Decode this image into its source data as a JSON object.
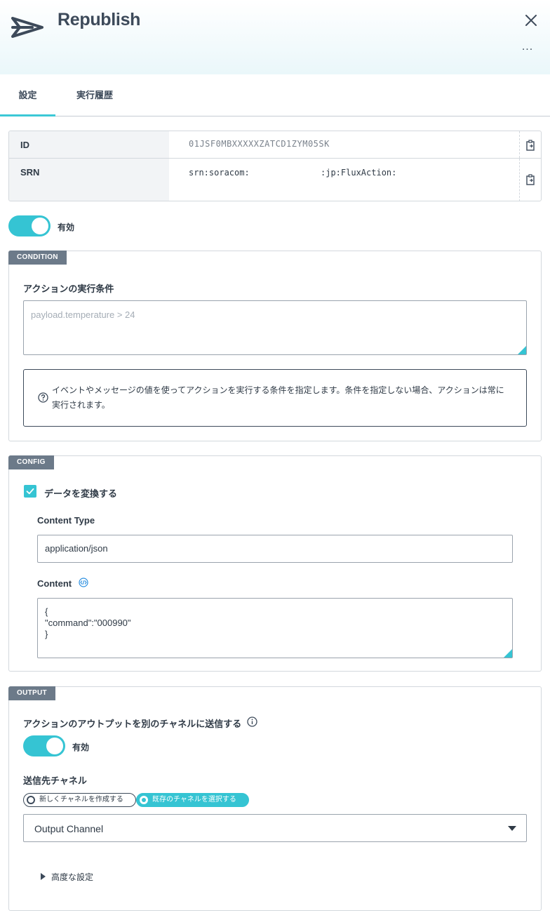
{
  "header": {
    "title": "Republish",
    "more_label": "..."
  },
  "tabs": [
    {
      "label": "設定",
      "active": true
    },
    {
      "label": "実行履歴",
      "active": false
    }
  ],
  "info": {
    "id_label": "ID",
    "id_value": "01JSF0MBXXXXXZATCD1ZYM05SK",
    "srn_label": "SRN",
    "srn_prefix": "srn:soracom:",
    "srn_suffix": ":jp:FluxAction:"
  },
  "enabled_toggle": {
    "label": "有効",
    "on": true
  },
  "condition": {
    "badge": "CONDITION",
    "label": "アクションの実行条件",
    "placeholder": "payload.temperature > 24",
    "note": "イベントやメッセージの値を使ってアクションを実行する条件を指定します。条件を指定しない場合、アクションは常に実行されます。"
  },
  "config": {
    "badge": "CONFIG",
    "transform_label": "データを変換する",
    "transform_checked": true,
    "content_type_label": "Content Type",
    "content_type_value": "application/json",
    "content_label": "Content",
    "content_lines": [
      "{",
      "\"command\":\"000990\"",
      "}"
    ]
  },
  "output": {
    "badge": "OUTPUT",
    "send_label": "アクションのアウトプットを別のチャネルに送信する",
    "toggle_label": "有効",
    "channel_label": "送信先チャネル",
    "radio_new": "新しくチャネルを作成する",
    "radio_existing": "既存のチャネルを選択する",
    "selected_channel": "Output Channel",
    "advanced_label": "高度な設定"
  },
  "colors": {
    "accent": "#35c4d3",
    "text": "#2f3a46",
    "badge_bg": "#6c7a89"
  }
}
